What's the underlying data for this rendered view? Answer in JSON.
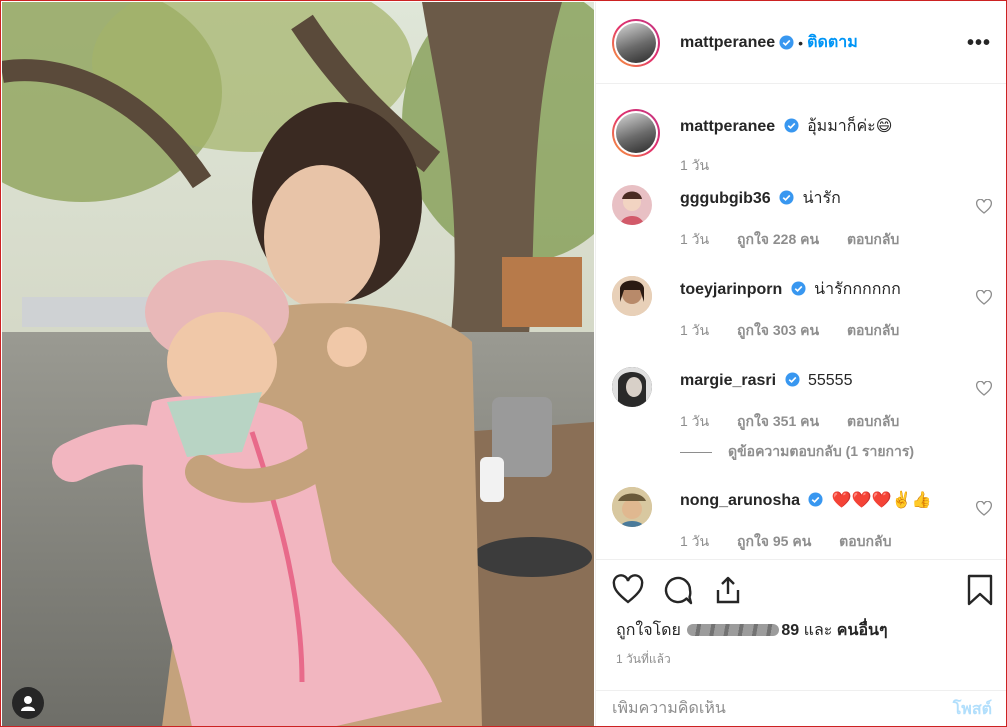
{
  "post": {
    "username": "mattperanee",
    "follow_label": "ติดตาม",
    "separator": "•",
    "more_label": "•••",
    "caption": {
      "username": "mattperanee",
      "text": "อุ้มมาก็ค่ะ😄",
      "time": "1 วัน"
    },
    "comments": [
      {
        "username": "gggubgib36",
        "text": "น่ารัก",
        "time": "1 วัน",
        "likes": "ถูกใจ 228 คน",
        "reply": "ตอบกลับ",
        "avatar_color": "#e8c0c4"
      },
      {
        "username": "toeyjarinporn",
        "text": "น่ารักกกกกก",
        "time": "1 วัน",
        "likes": "ถูกใจ 303 คน",
        "reply": "ตอบกลับ",
        "avatar_color": "#b88a6a"
      },
      {
        "username": "margie_rasri",
        "text": "55555",
        "time": "1 วัน",
        "likes": "ถูกใจ 351 คน",
        "reply": "ตอบกลับ",
        "avatar_color": "#4a4a4a",
        "view_replies": "ดูข้อความตอบกลับ (1 รายการ)"
      },
      {
        "username": "nong_arunosha",
        "text": "❤️❤️❤️✌️👍",
        "time": "1 วัน",
        "likes": "ถูกใจ 95 คน",
        "reply": "ตอบกลับ",
        "avatar_color": "#c9a86a"
      }
    ],
    "liked_by_prefix": "ถูกใจโดย",
    "liked_by_suffix": "89",
    "liked_by_and": "และ",
    "liked_by_others": "คนอื่นๆ",
    "timestamp": "1 วันที่แล้ว",
    "add_comment_placeholder": "เพิ่มความคิดเห็น",
    "post_button": "โพสต์"
  },
  "colors": {
    "link_blue": "#0095f6",
    "verified_blue": "#3897f0",
    "post_disabled": "#b2dffc",
    "meta_gray": "#8e8e8e"
  }
}
